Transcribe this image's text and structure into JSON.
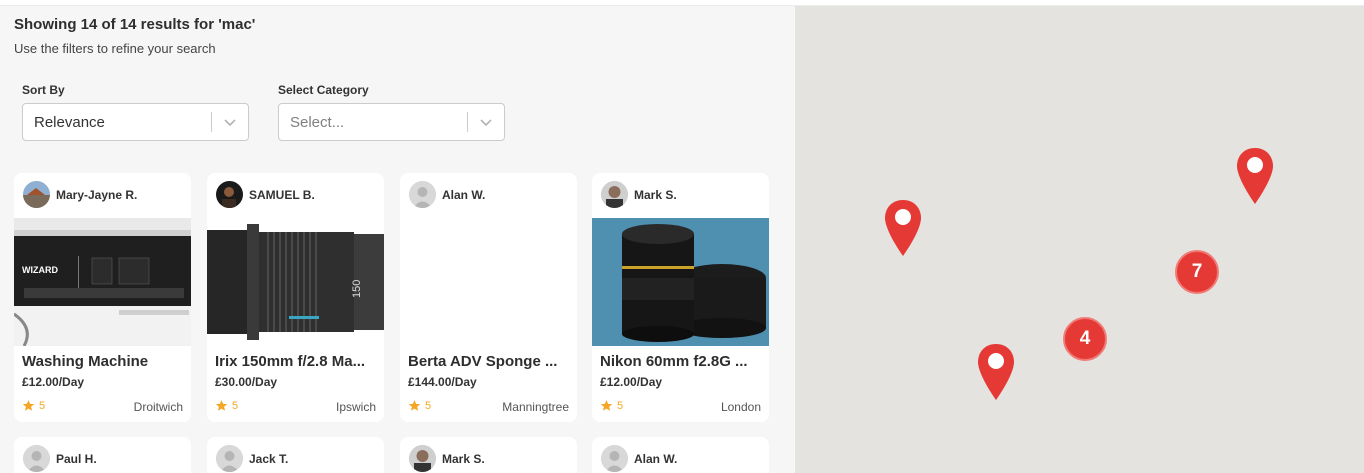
{
  "results": {
    "title": "Showing 14 of 14 results for 'mac'",
    "subtitle": "Use the filters to refine your search"
  },
  "filters": {
    "sort_label": "Sort By",
    "sort_value": "Relevance",
    "category_label": "Select Category",
    "category_placeholder": "Select..."
  },
  "listings": [
    {
      "user": "Mary-Jayne R.",
      "title": "Washing Machine",
      "price": "£12.00/Day",
      "rating": "5",
      "location": "Droitwich",
      "image": "washing-machine-photo",
      "avatar": "house-photo-avatar"
    },
    {
      "user": "SAMUEL B.",
      "title": "Irix 150mm f/2.8 Ma...",
      "price": "£30.00/Day",
      "rating": "5",
      "location": "Ipswich",
      "image": "camera-lens-photo",
      "avatar": "person-photo-avatar"
    },
    {
      "user": "Alan W.",
      "title": "Berta ADV Sponge ...",
      "price": "£144.00/Day",
      "rating": "5",
      "location": "Manningtree",
      "image": "",
      "avatar": "default-user-avatar"
    },
    {
      "user": "Mark S.",
      "title": "Nikon 60mm f2.8G ...",
      "price": "£12.00/Day",
      "rating": "5",
      "location": "London",
      "image": "nikon-lens-photo",
      "avatar": "person-photo-avatar"
    }
  ],
  "listings_row2": [
    {
      "user": "Paul H.",
      "avatar": "default-user-avatar"
    },
    {
      "user": "Jack T.",
      "avatar": "default-user-avatar"
    },
    {
      "user": "Mark S.",
      "avatar": "person-photo-avatar"
    },
    {
      "user": "Alan W.",
      "avatar": "default-user-avatar"
    }
  ],
  "map": {
    "clusters": [
      "7",
      "4"
    ],
    "marker_color": "#e53935",
    "background": "#e5e3df"
  },
  "colors": {
    "star": "#f5a623"
  }
}
